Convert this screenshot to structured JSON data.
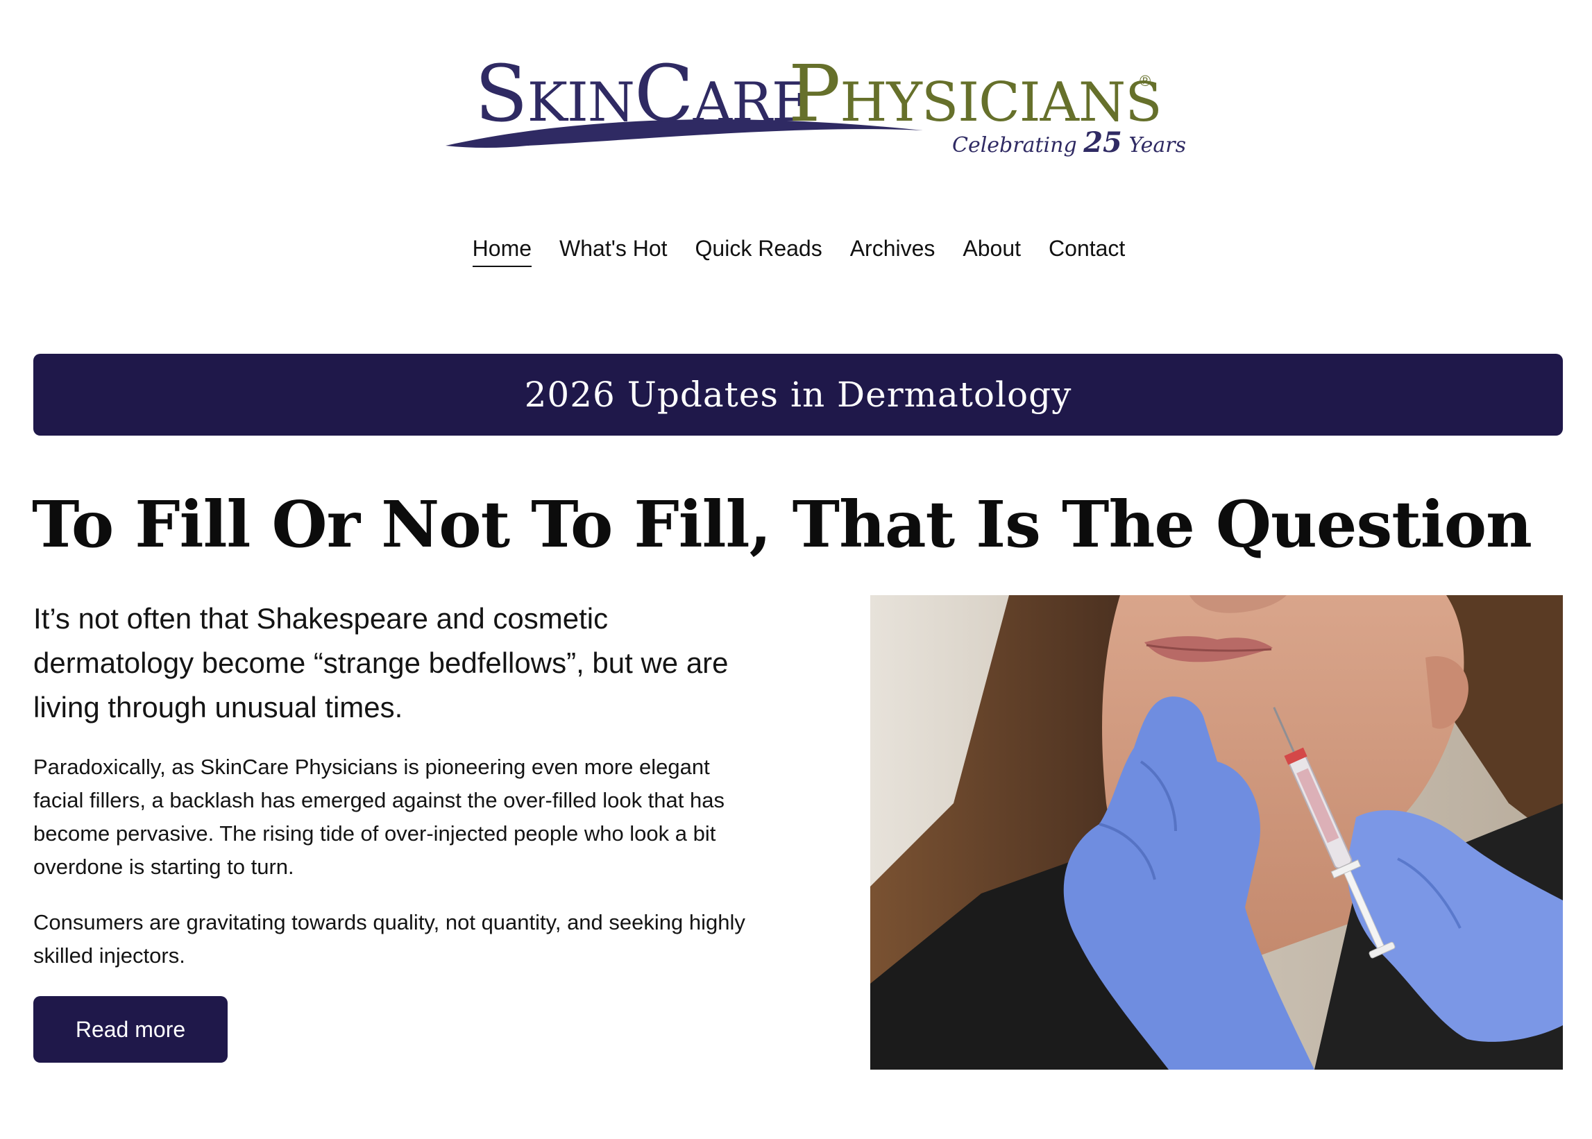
{
  "logo": {
    "brand_part1": "SkinCare",
    "brand_part2": "Physicians",
    "registered_mark": "®",
    "tagline_pre": "Celebrating ",
    "tagline_num": "25",
    "tagline_post": " Years",
    "colors": {
      "skincare": "#2f2a63",
      "physicians": "#66702b"
    }
  },
  "nav": {
    "items": [
      {
        "label": "Home",
        "active": true
      },
      {
        "label": "What's Hot"
      },
      {
        "label": "Quick Reads"
      },
      {
        "label": "Archives"
      },
      {
        "label": "About"
      },
      {
        "label": "Contact"
      }
    ]
  },
  "banner": {
    "title": "2026 Updates in Dermatology",
    "color": "#1f184a"
  },
  "article": {
    "headline": "To Fill Or Not To Fill, That Is The Question",
    "lede": "It’s not often that Shakespeare and cosmetic dermatology become “strange bedfellows”, but we are living through unusual times.",
    "paragraph1": "Paradoxically, as SkinCare Physicians is pioneering even more elegant facial fillers, a backlash has emerged against the over-filled look that has become pervasive. The rising tide of over-injected  people who look a bit overdone is starting to turn.",
    "paragraph2": "Consumers are gravitating towards quality, not quantity, and seeking highly skilled injectors.",
    "read_more_label": "Read more",
    "image_subject": "gloved-hands-injecting-filler-in-chin"
  }
}
